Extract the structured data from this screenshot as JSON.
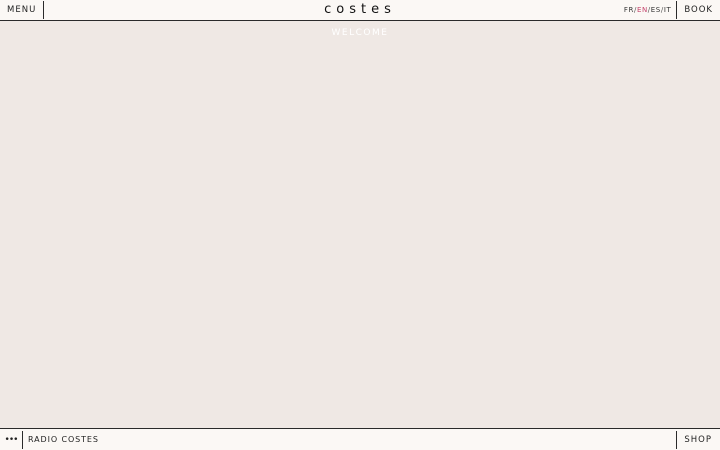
{
  "header": {
    "menu_label": "MENU",
    "logo": "costes",
    "languages": [
      "FR",
      "EN",
      "ES",
      "IT"
    ],
    "active_language": "EN",
    "book_label": "BOOK"
  },
  "main": {
    "welcome": "WELCOME"
  },
  "footer": {
    "more_icon": "ellipsis-icon",
    "radio_label": "RADIO COSTES",
    "shop_label": "SHOP"
  },
  "colors": {
    "background": "#efe8e4",
    "bar": "#fbf8f5",
    "active_language": "#c4436b"
  }
}
